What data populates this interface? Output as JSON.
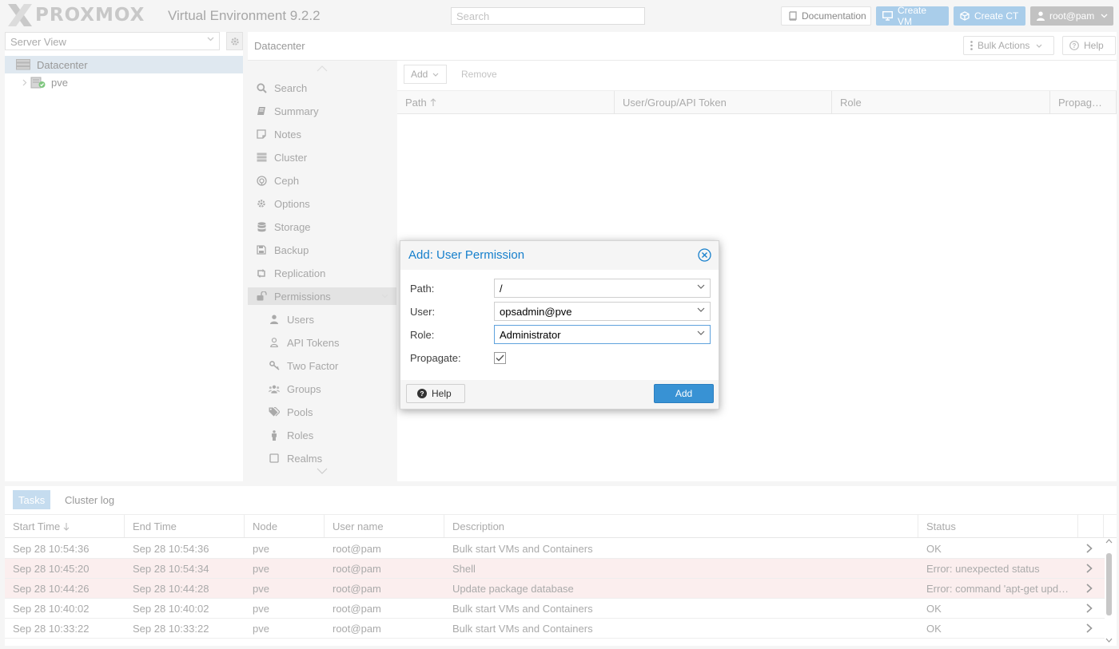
{
  "header": {
    "logo_text": "PROXMOX",
    "version": "Virtual Environment 9.2.2",
    "search_placeholder": "Search",
    "documentation": "Documentation",
    "create_vm": "Create VM",
    "create_ct": "Create CT",
    "user": "root@pam"
  },
  "tree": {
    "view": "Server View",
    "datacenter": "Datacenter",
    "node": "pve"
  },
  "content": {
    "title": "Datacenter",
    "bulk_actions": "Bulk Actions",
    "help": "Help"
  },
  "nav": {
    "items": [
      "Search",
      "Summary",
      "Notes",
      "Cluster",
      "Ceph",
      "Options",
      "Storage",
      "Backup",
      "Replication",
      "Permissions",
      "Users",
      "API Tokens",
      "Two Factor",
      "Groups",
      "Pools",
      "Roles",
      "Realms"
    ],
    "active": "Permissions"
  },
  "permissions": {
    "add": "Add",
    "remove": "Remove",
    "columns": [
      "Path",
      "User/Group/API Token",
      "Role",
      "Propag…"
    ]
  },
  "tasks": {
    "tabs": [
      "Tasks",
      "Cluster log"
    ],
    "columns": [
      "Start Time",
      "End Time",
      "Node",
      "User name",
      "Description",
      "Status"
    ],
    "rows": [
      {
        "start": "Sep 28 10:54:36",
        "end": "Sep 28 10:54:36",
        "node": "pve",
        "user": "root@pam",
        "desc": "Bulk start VMs and Containers",
        "status": "OK",
        "error": false
      },
      {
        "start": "Sep 28 10:45:20",
        "end": "Sep 28 10:54:34",
        "node": "pve",
        "user": "root@pam",
        "desc": "Shell",
        "status": "Error: unexpected status",
        "error": true
      },
      {
        "start": "Sep 28 10:44:26",
        "end": "Sep 28 10:44:28",
        "node": "pve",
        "user": "root@pam",
        "desc": "Update package database",
        "status": "Error: command 'apt-get upd…",
        "error": true
      },
      {
        "start": "Sep 28 10:40:02",
        "end": "Sep 28 10:40:02",
        "node": "pve",
        "user": "root@pam",
        "desc": "Bulk start VMs and Containers",
        "status": "OK",
        "error": false
      },
      {
        "start": "Sep 28 10:33:22",
        "end": "Sep 28 10:33:22",
        "node": "pve",
        "user": "root@pam",
        "desc": "Bulk start VMs and Containers",
        "status": "OK",
        "error": false
      }
    ]
  },
  "dialog": {
    "title": "Add: User Permission",
    "path_label": "Path:",
    "path_value": "/",
    "user_label": "User:",
    "user_value": "opsadmin@pve",
    "role_label": "Role:",
    "role_value": "Administrator",
    "propagate_label": "Propagate:",
    "propagate_checked": true,
    "help": "Help",
    "add": "Add"
  },
  "colors": {
    "accent": "#3892d4",
    "title_blue": "#157fcc",
    "proxmox_orange": "#e57000",
    "error_row": "#fbeeee"
  }
}
